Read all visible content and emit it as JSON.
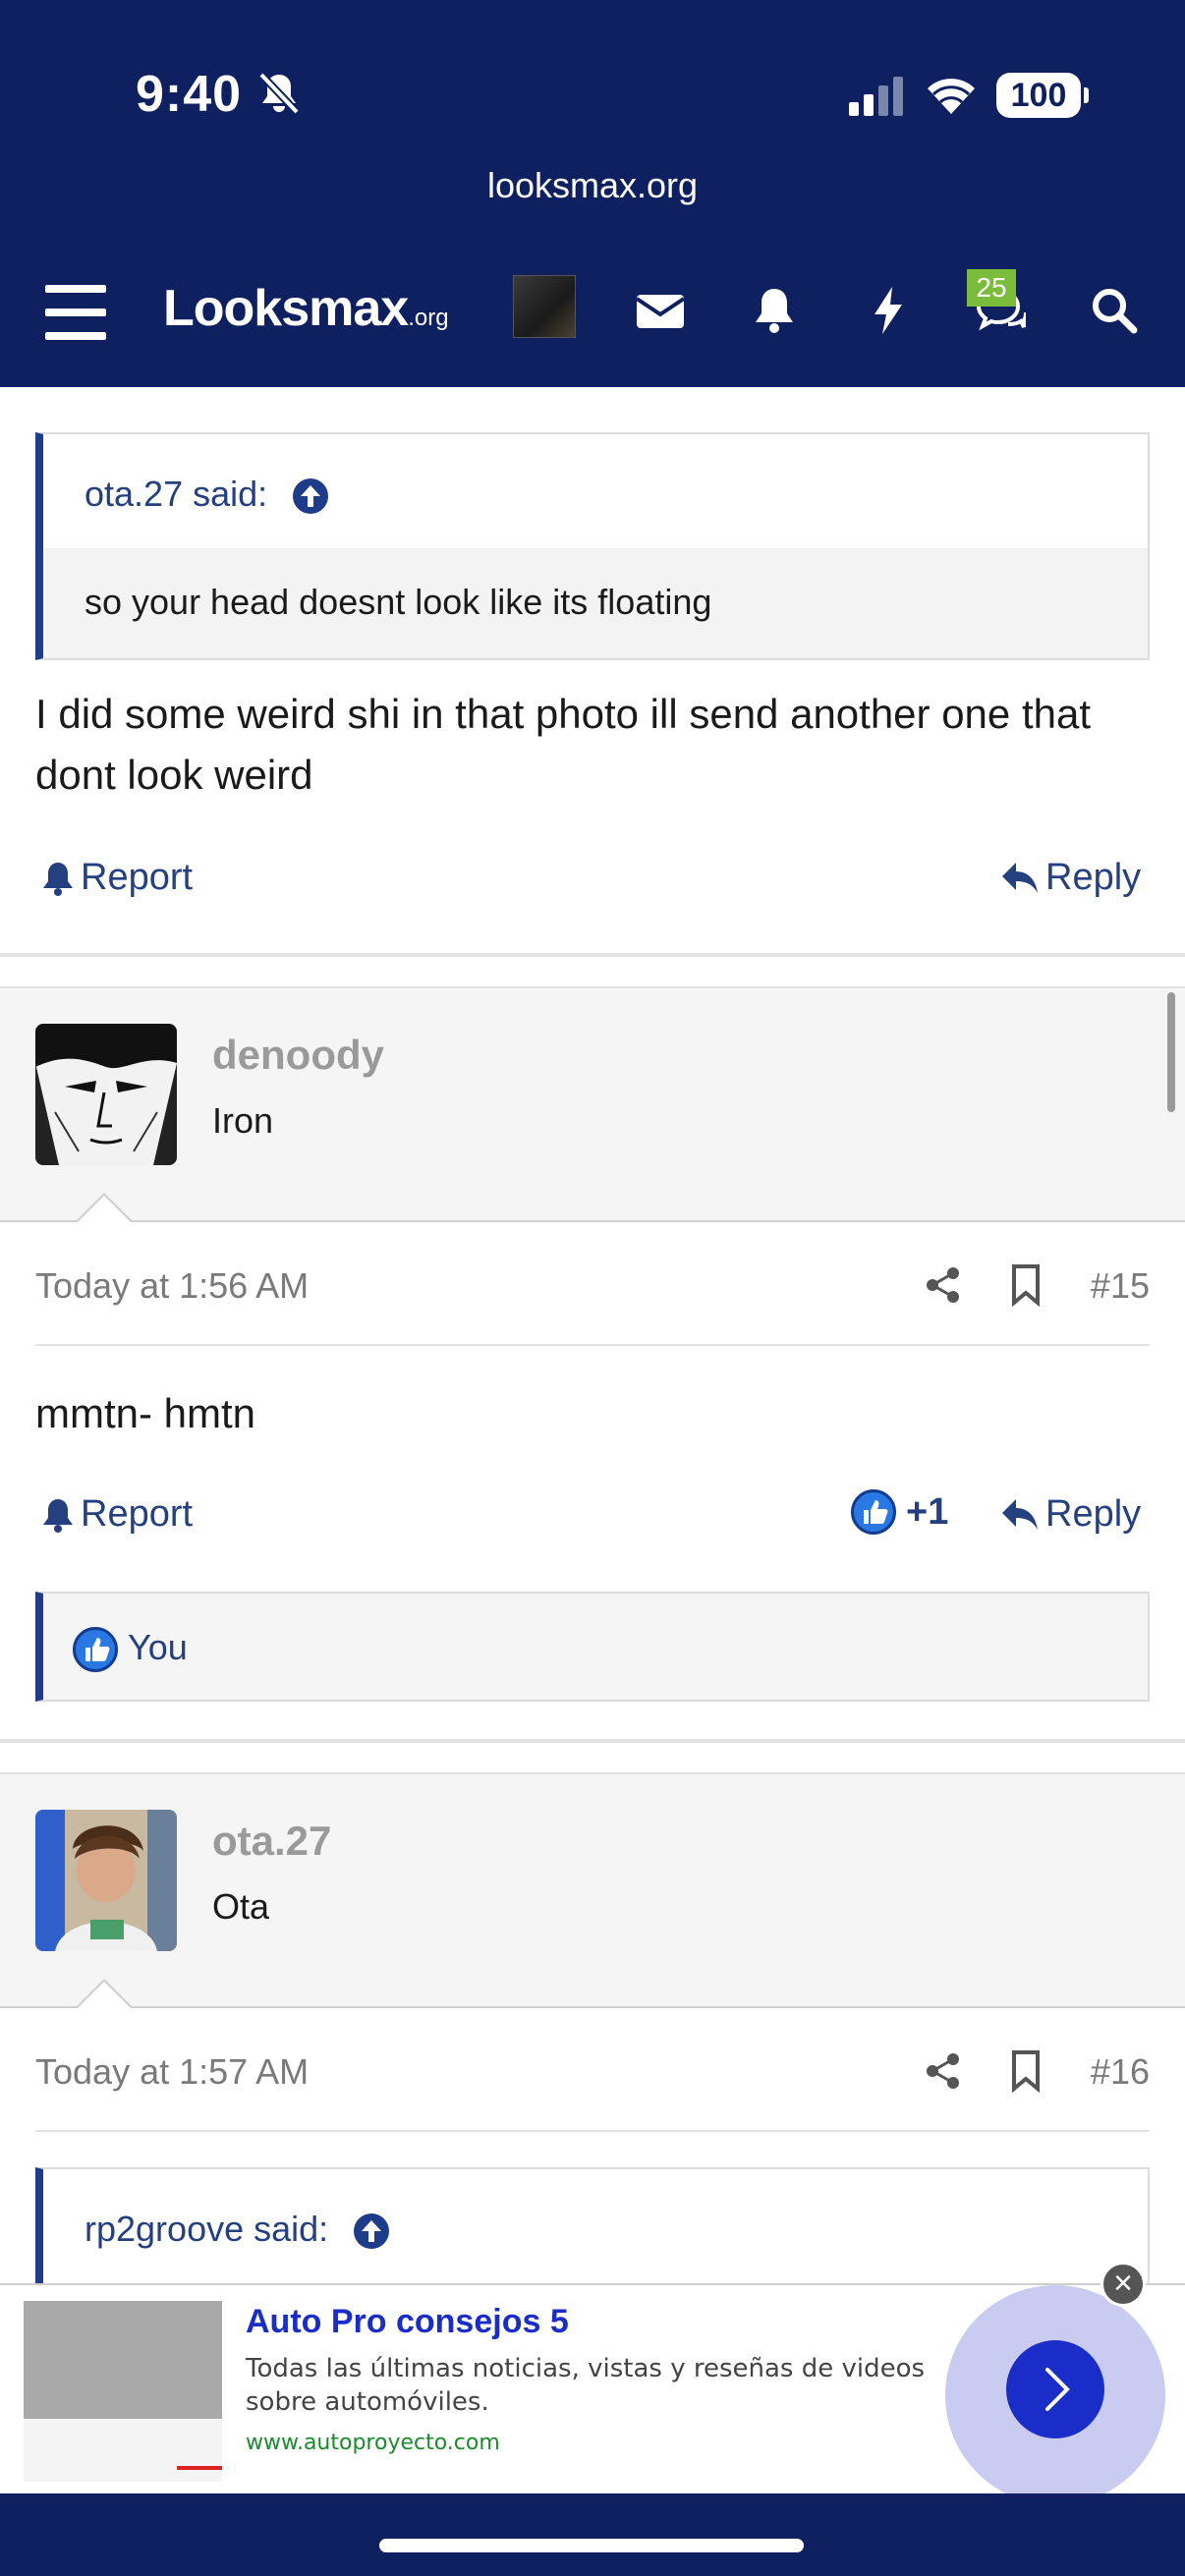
{
  "status_bar": {
    "time": "9:40",
    "battery": "100",
    "url": "looksmax.org"
  },
  "navbar": {
    "logo_main": "Looksmax",
    "logo_suffix": ".org",
    "badge_count": "25"
  },
  "colors": {
    "header_bg": "#0e2060",
    "link": "#25407f",
    "quote_accent": "#1e3c8a",
    "badge": "#7bbd3a"
  },
  "post_14": {
    "quote_author": "ota.27 said:",
    "quote_text": "so your head doesnt look like its floating",
    "body": "I did some weird shi in that photo ill send another one that dont look weird",
    "report_label": "Report",
    "reply_label": "Reply"
  },
  "post_15": {
    "username": "denoody",
    "user_title": "Iron",
    "timestamp": "Today at 1:56 AM",
    "post_number": "#15",
    "body": "mmtn- hmtn",
    "report_label": "Report",
    "reaction_count": "+1",
    "reply_label": "Reply",
    "reacted_by": "You"
  },
  "post_16": {
    "username": "ota.27",
    "user_title": "Ota",
    "timestamp": "Today at 1:57 AM",
    "post_number": "#16",
    "quote_author": "rp2groove said:"
  },
  "ad": {
    "title": "Auto Pro consejos 5",
    "description": "Todas las últimas noticias, vistas y reseñas de videos sobre automóviles.",
    "url": "www.autoproyecto.com"
  }
}
